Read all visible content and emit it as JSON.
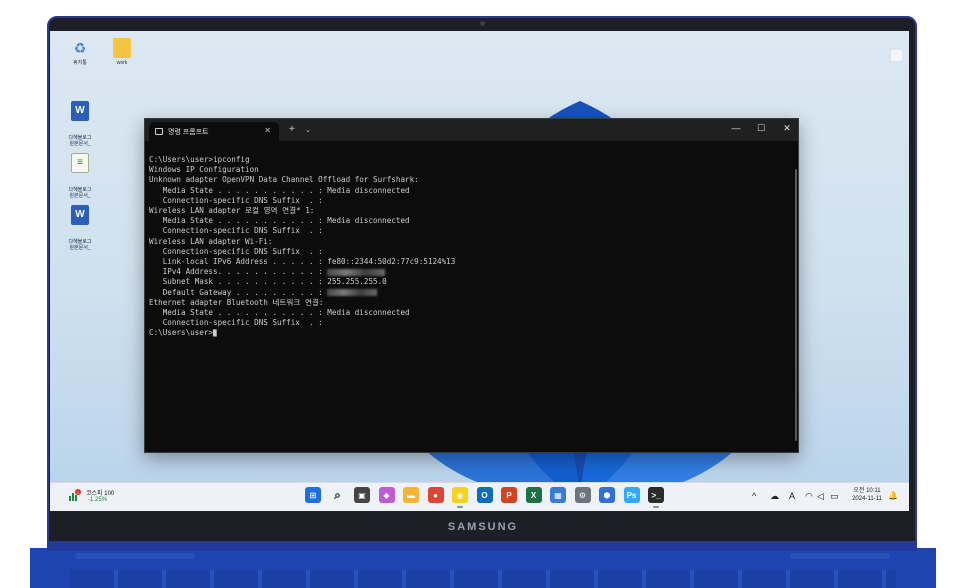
{
  "laptop": {
    "brand": "SAMSUNG"
  },
  "desktop_icons": [
    {
      "label": "휴지통",
      "icon": "recycle-bin-icon"
    },
    {
      "label": "work",
      "icon": "folder-icon"
    },
    {
      "label": "다혜블로그\n원본문서_",
      "icon": "word-document-icon"
    },
    {
      "label": "다혜블로그\n원본문서_",
      "icon": "text-document-icon"
    },
    {
      "label": "다혜블로그\n원본문서_",
      "icon": "word-document-icon"
    }
  ],
  "terminal": {
    "tab_title": "명령 프롬프트",
    "new_tab": "+",
    "tab_dropdown": "⌄",
    "window_controls": {
      "minimize": "—",
      "maximize": "☐",
      "close": "✕"
    },
    "lines": [
      "C:\\Users\\user>ipconfig",
      "",
      "Windows IP Configuration",
      "",
      "",
      "Unknown adapter OpenVPN Data Channel Offload for Surfshark:",
      "",
      "   Media State . . . . . . . . . . . : Media disconnected",
      "   Connection-specific DNS Suffix  . :",
      "",
      "Wireless LAN adapter 로컬 영역 연결* 1:",
      "",
      "   Media State . . . . . . . . . . . : Media disconnected",
      "   Connection-specific DNS Suffix  . :",
      "",
      "Wireless LAN adapter Wi-Fi:",
      "",
      "   Connection-specific DNS Suffix  . :",
      "   Link-local IPv6 Address . . . . . : fe80::2344:50d2:77c9:5124%13",
      "   IPv4 Address. . . . . . . . . . . : ",
      "   Subnet Mask . . . . . . . . . . . : 255.255.255.0",
      "   Default Gateway . . . . . . . . . : ",
      "",
      "Ethernet adapter Bluetooth 네트워크 연결:",
      "",
      "   Media State . . . . . . . . . . . : Media disconnected",
      "   Connection-specific DNS Suffix  . :",
      "",
      "C:\\Users\\user>"
    ]
  },
  "taskbar": {
    "stock_widget": {
      "name": "코스피",
      "value": "100",
      "change": "-1.25%",
      "badge": "1"
    },
    "apps": [
      {
        "name": "start-button",
        "glyph": "⊞",
        "color": "#1e6fd9"
      },
      {
        "name": "search-button",
        "glyph": "⌕",
        "color": "#333333"
      },
      {
        "name": "task-view-button",
        "glyph": "▣",
        "color": "#444444"
      },
      {
        "name": "copilot-button",
        "glyph": "◆",
        "color": "#c05bd6"
      },
      {
        "name": "file-explorer-button",
        "glyph": "▬",
        "color": "#f2b632"
      },
      {
        "name": "chrome-button",
        "glyph": "●",
        "color": "#db4437"
      },
      {
        "name": "kakaotalk-button",
        "glyph": "◉",
        "color": "#f7d21a"
      },
      {
        "name": "outlook-button",
        "glyph": "O",
        "color": "#0f6cbd"
      },
      {
        "name": "powerpoint-button",
        "glyph": "P",
        "color": "#d04423"
      },
      {
        "name": "excel-button",
        "glyph": "X",
        "color": "#1d7044"
      },
      {
        "name": "image-viewer-button",
        "glyph": "▦",
        "color": "#3a7bd5"
      },
      {
        "name": "settings-button",
        "glyph": "⚙",
        "color": "#6b7280"
      },
      {
        "name": "defender-button",
        "glyph": "⬢",
        "color": "#2f6fd6"
      },
      {
        "name": "photoshop-button",
        "glyph": "Ps",
        "color": "#31a8ff"
      },
      {
        "name": "terminal-button",
        "glyph": ">_",
        "color": "#2b2b2b"
      }
    ],
    "tray": {
      "chevron": "^",
      "cloud": "☁",
      "ime": "A",
      "wifi": "◠",
      "volume": "◁",
      "battery": "▭"
    },
    "clock": {
      "time": "오전 10:11",
      "date": "2024-11-11"
    },
    "notification": "🔔"
  }
}
